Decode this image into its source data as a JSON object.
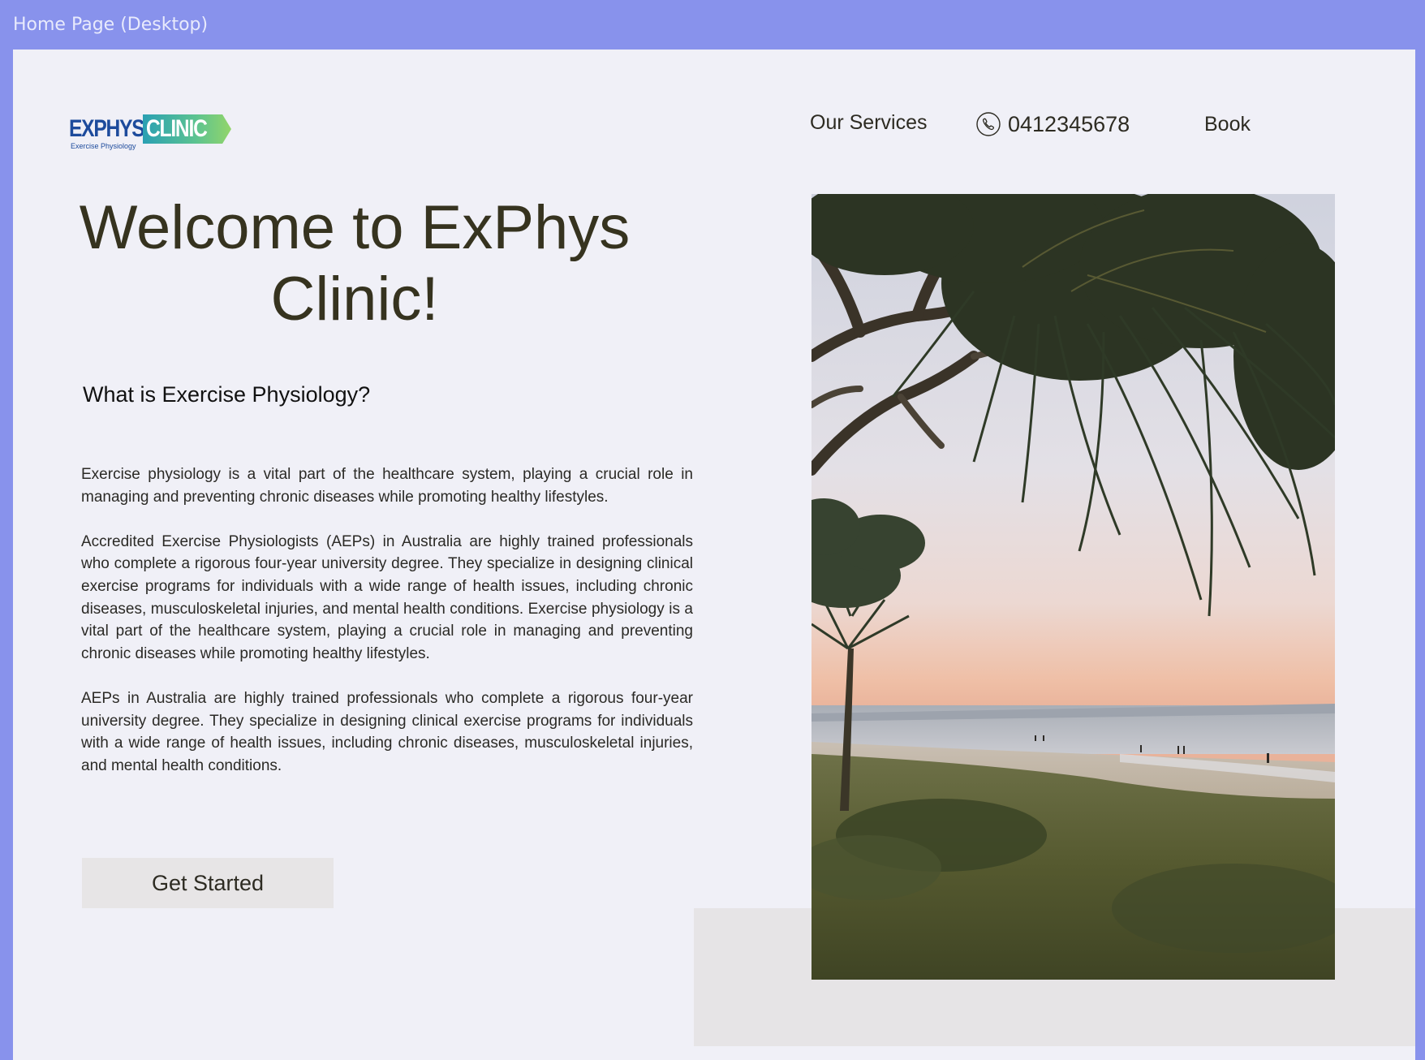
{
  "frame": {
    "title": "Home Page (Desktop)"
  },
  "logo": {
    "word1": "EXPHYS",
    "word2": "CLINIC",
    "tagline": "Exercise Physiology"
  },
  "nav": {
    "services_label": "Our Services",
    "phone_number": "0412345678",
    "book_label": "Book"
  },
  "hero": {
    "headline": "Welcome to ExPhys Clinic!",
    "subheading": "What is Exercise Physiology?",
    "paragraphs": [
      "Exercise physiology is a vital part of the healthcare system, playing a crucial role in managing and preventing chronic diseases while promoting healthy lifestyles.",
      "Accredited Exercise Physiologists (AEPs) in Australia are highly trained professionals who complete a rigorous four-year university degree. They specialize in designing clinical exercise programs for individuals with a wide range of health issues, including chronic diseases, musculoskeletal injuries, and mental health conditions. Exercise physiology is a vital part of the healthcare system, playing a crucial role in managing and preventing chronic diseases while promoting healthy lifestyles.",
      "AEPs in Australia are highly trained professionals who complete a rigorous four-year university degree. They specialize in designing clinical exercise programs for individuals with a wide range of health issues, including chronic diseases, musculoskeletal injuries, and mental health conditions."
    ],
    "cta_label": "Get Started"
  },
  "colors": {
    "frame_background": "#8892ec",
    "page_background": "#f0f0f7",
    "heading_text": "#36331f",
    "button_background": "#e7e5e6",
    "logo_blue": "#1d4b9c",
    "logo_green": "#93d56a"
  },
  "icons": {
    "phone": "phone-icon"
  }
}
